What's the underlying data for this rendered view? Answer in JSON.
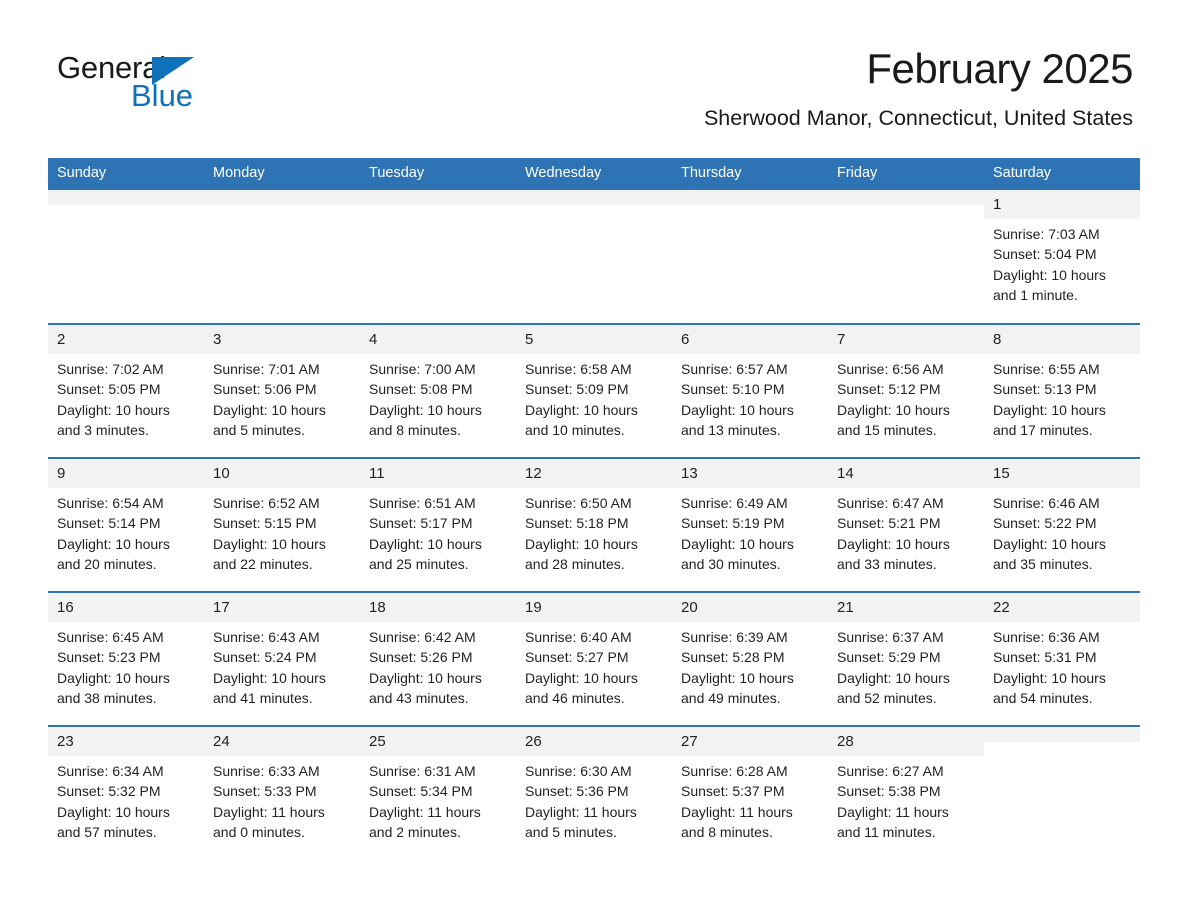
{
  "brand": {
    "name_part1": "General",
    "name_part2": "Blue",
    "triangle_color": "#1071bb"
  },
  "header": {
    "title": "February 2025",
    "subtitle": "Sherwood Manor, Connecticut, United States"
  },
  "colors": {
    "header_blue": "#2e74b5",
    "daynum_band": "#f2f2f2",
    "text": "#231f20"
  },
  "weekday_headers": [
    "Sunday",
    "Monday",
    "Tuesday",
    "Wednesday",
    "Thursday",
    "Friday",
    "Saturday"
  ],
  "weeks": [
    [
      {
        "day": "",
        "empty": true
      },
      {
        "day": "",
        "empty": true
      },
      {
        "day": "",
        "empty": true
      },
      {
        "day": "",
        "empty": true
      },
      {
        "day": "",
        "empty": true
      },
      {
        "day": "",
        "empty": true
      },
      {
        "day": "1",
        "sunrise": "Sunrise: 7:03 AM",
        "sunset": "Sunset: 5:04 PM",
        "daylight": "Daylight: 10 hours and 1 minute."
      }
    ],
    [
      {
        "day": "2",
        "sunrise": "Sunrise: 7:02 AM",
        "sunset": "Sunset: 5:05 PM",
        "daylight": "Daylight: 10 hours and 3 minutes."
      },
      {
        "day": "3",
        "sunrise": "Sunrise: 7:01 AM",
        "sunset": "Sunset: 5:06 PM",
        "daylight": "Daylight: 10 hours and 5 minutes."
      },
      {
        "day": "4",
        "sunrise": "Sunrise: 7:00 AM",
        "sunset": "Sunset: 5:08 PM",
        "daylight": "Daylight: 10 hours and 8 minutes."
      },
      {
        "day": "5",
        "sunrise": "Sunrise: 6:58 AM",
        "sunset": "Sunset: 5:09 PM",
        "daylight": "Daylight: 10 hours and 10 minutes."
      },
      {
        "day": "6",
        "sunrise": "Sunrise: 6:57 AM",
        "sunset": "Sunset: 5:10 PM",
        "daylight": "Daylight: 10 hours and 13 minutes."
      },
      {
        "day": "7",
        "sunrise": "Sunrise: 6:56 AM",
        "sunset": "Sunset: 5:12 PM",
        "daylight": "Daylight: 10 hours and 15 minutes."
      },
      {
        "day": "8",
        "sunrise": "Sunrise: 6:55 AM",
        "sunset": "Sunset: 5:13 PM",
        "daylight": "Daylight: 10 hours and 17 minutes."
      }
    ],
    [
      {
        "day": "9",
        "sunrise": "Sunrise: 6:54 AM",
        "sunset": "Sunset: 5:14 PM",
        "daylight": "Daylight: 10 hours and 20 minutes."
      },
      {
        "day": "10",
        "sunrise": "Sunrise: 6:52 AM",
        "sunset": "Sunset: 5:15 PM",
        "daylight": "Daylight: 10 hours and 22 minutes."
      },
      {
        "day": "11",
        "sunrise": "Sunrise: 6:51 AM",
        "sunset": "Sunset: 5:17 PM",
        "daylight": "Daylight: 10 hours and 25 minutes."
      },
      {
        "day": "12",
        "sunrise": "Sunrise: 6:50 AM",
        "sunset": "Sunset: 5:18 PM",
        "daylight": "Daylight: 10 hours and 28 minutes."
      },
      {
        "day": "13",
        "sunrise": "Sunrise: 6:49 AM",
        "sunset": "Sunset: 5:19 PM",
        "daylight": "Daylight: 10 hours and 30 minutes."
      },
      {
        "day": "14",
        "sunrise": "Sunrise: 6:47 AM",
        "sunset": "Sunset: 5:21 PM",
        "daylight": "Daylight: 10 hours and 33 minutes."
      },
      {
        "day": "15",
        "sunrise": "Sunrise: 6:46 AM",
        "sunset": "Sunset: 5:22 PM",
        "daylight": "Daylight: 10 hours and 35 minutes."
      }
    ],
    [
      {
        "day": "16",
        "sunrise": "Sunrise: 6:45 AM",
        "sunset": "Sunset: 5:23 PM",
        "daylight": "Daylight: 10 hours and 38 minutes."
      },
      {
        "day": "17",
        "sunrise": "Sunrise: 6:43 AM",
        "sunset": "Sunset: 5:24 PM",
        "daylight": "Daylight: 10 hours and 41 minutes."
      },
      {
        "day": "18",
        "sunrise": "Sunrise: 6:42 AM",
        "sunset": "Sunset: 5:26 PM",
        "daylight": "Daylight: 10 hours and 43 minutes."
      },
      {
        "day": "19",
        "sunrise": "Sunrise: 6:40 AM",
        "sunset": "Sunset: 5:27 PM",
        "daylight": "Daylight: 10 hours and 46 minutes."
      },
      {
        "day": "20",
        "sunrise": "Sunrise: 6:39 AM",
        "sunset": "Sunset: 5:28 PM",
        "daylight": "Daylight: 10 hours and 49 minutes."
      },
      {
        "day": "21",
        "sunrise": "Sunrise: 6:37 AM",
        "sunset": "Sunset: 5:29 PM",
        "daylight": "Daylight: 10 hours and 52 minutes."
      },
      {
        "day": "22",
        "sunrise": "Sunrise: 6:36 AM",
        "sunset": "Sunset: 5:31 PM",
        "daylight": "Daylight: 10 hours and 54 minutes."
      }
    ],
    [
      {
        "day": "23",
        "sunrise": "Sunrise: 6:34 AM",
        "sunset": "Sunset: 5:32 PM",
        "daylight": "Daylight: 10 hours and 57 minutes."
      },
      {
        "day": "24",
        "sunrise": "Sunrise: 6:33 AM",
        "sunset": "Sunset: 5:33 PM",
        "daylight": "Daylight: 11 hours and 0 minutes."
      },
      {
        "day": "25",
        "sunrise": "Sunrise: 6:31 AM",
        "sunset": "Sunset: 5:34 PM",
        "daylight": "Daylight: 11 hours and 2 minutes."
      },
      {
        "day": "26",
        "sunrise": "Sunrise: 6:30 AM",
        "sunset": "Sunset: 5:36 PM",
        "daylight": "Daylight: 11 hours and 5 minutes."
      },
      {
        "day": "27",
        "sunrise": "Sunrise: 6:28 AM",
        "sunset": "Sunset: 5:37 PM",
        "daylight": "Daylight: 11 hours and 8 minutes."
      },
      {
        "day": "28",
        "sunrise": "Sunrise: 6:27 AM",
        "sunset": "Sunset: 5:38 PM",
        "daylight": "Daylight: 11 hours and 11 minutes."
      },
      {
        "day": "",
        "empty": true
      }
    ]
  ]
}
